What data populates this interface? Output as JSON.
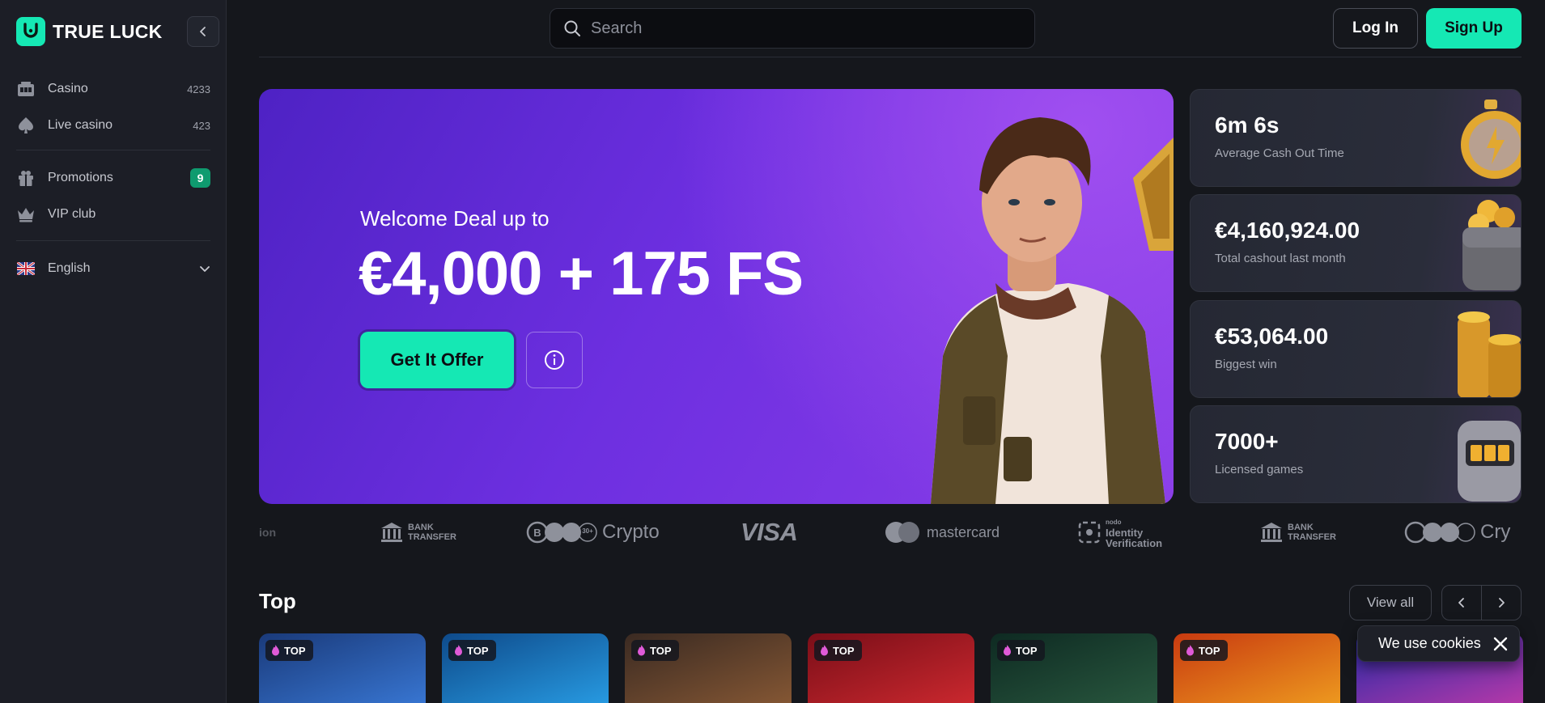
{
  "brand": {
    "name": "TRUE LUCK",
    "accent": "#15e8b4"
  },
  "sidebar": {
    "items": [
      {
        "label": "Casino",
        "count": "4233",
        "icon": "casino-icon"
      },
      {
        "label": "Live casino",
        "count": "423",
        "icon": "spade-icon"
      },
      {
        "label": "Promotions",
        "badge": "9",
        "icon": "gift-icon"
      },
      {
        "label": "VIP club",
        "icon": "crown-icon"
      }
    ],
    "language": {
      "label": "English",
      "icon": "uk-flag-icon"
    }
  },
  "header": {
    "search_placeholder": "Search",
    "login_label": "Log In",
    "signup_label": "Sign Up"
  },
  "hero": {
    "subtitle": "Welcome Deal up to",
    "title": "€4,000 + 175 FS",
    "cta_label": "Get It Offer",
    "info_icon": "info-icon"
  },
  "stats": [
    {
      "value": "6m 6s",
      "label": "Average Cash Out Time",
      "icon": "stopwatch-icon"
    },
    {
      "value": "€4,160,924.00",
      "label": "Total cashout last month",
      "icon": "wallet-icon"
    },
    {
      "value": "€53,064.00",
      "label": "Biggest win",
      "icon": "coins-icon"
    },
    {
      "value": "7000+",
      "label": "Licensed games",
      "icon": "slot-machine-icon"
    }
  ],
  "payments": {
    "partial_left": "ion",
    "bank_line1": "BANK",
    "bank_line2": "TRANSFER",
    "crypto_label": "Crypto",
    "crypto_more": "30+",
    "visa": "VISA",
    "mastercard": "mastercard",
    "identity_small": "nodo",
    "identity_line1": "Identity",
    "identity_line2": "Verification",
    "crypto_partial": "Cry"
  },
  "top_section": {
    "title": "Top",
    "view_all_label": "View all",
    "card_tag": "TOP",
    "cards": [
      {
        "colors": [
          "#1a3a7a",
          "#3a7ad8"
        ]
      },
      {
        "colors": [
          "#0e4a8a",
          "#29a0e8"
        ]
      },
      {
        "colors": [
          "#3a2a22",
          "#8a5a35"
        ]
      },
      {
        "colors": [
          "#7a0e18",
          "#d02a30"
        ]
      },
      {
        "colors": [
          "#0e2a22",
          "#2a5a40"
        ]
      },
      {
        "colors": [
          "#c83a10",
          "#f0a020"
        ]
      },
      {
        "colors": [
          "#2a2aa8",
          "#c03aa8"
        ]
      }
    ]
  },
  "cookie": {
    "text": "We use cookies"
  }
}
